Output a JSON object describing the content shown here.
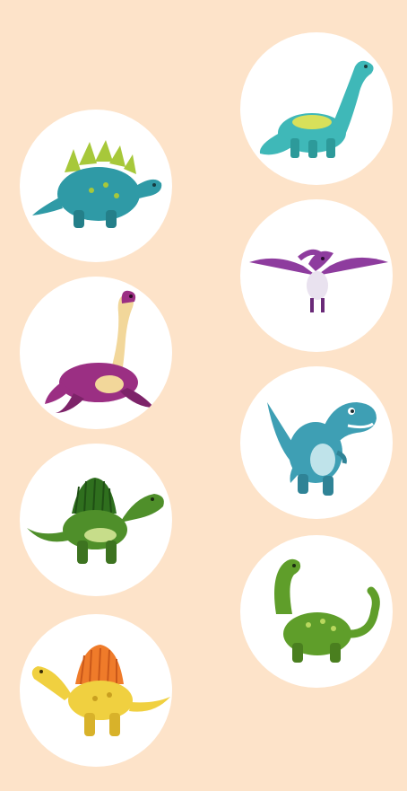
{
  "page": {
    "background": "#fde3c9",
    "card_color": "#ffffff"
  },
  "cards": [
    {
      "id": "brachiosaurus-teal",
      "icon": "long-neck-dinosaur-icon",
      "color": "#3fb8b8",
      "accent": "#d8e05a"
    },
    {
      "id": "stegosaurus-teal",
      "icon": "stegosaurus-icon",
      "color": "#2f9aa6",
      "accent": "#a7c83a"
    },
    {
      "id": "pterodactyl-purple",
      "icon": "pterodactyl-icon",
      "color": "#8e3c9e",
      "accent": "#e9e2ef"
    },
    {
      "id": "plesiosaur-magenta",
      "icon": "plesiosaur-icon",
      "color": "#9b2f83",
      "accent": "#f2d79a"
    },
    {
      "id": "trex-teal",
      "icon": "tyrannosaurus-icon",
      "color": "#3e9fb4",
      "accent": "#bfe3ea"
    },
    {
      "id": "spinosaurus-green",
      "icon": "spinosaurus-icon",
      "color": "#4f8f2a",
      "accent": "#c7dd8a"
    },
    {
      "id": "sauropod-green",
      "icon": "sauropod-icon",
      "color": "#5f9e2a",
      "accent": "#b9d85e"
    },
    {
      "id": "spinosaurus-yellow",
      "icon": "spinosaurus-yellow-icon",
      "color": "#f0d040",
      "accent": "#ef7b2a"
    }
  ]
}
